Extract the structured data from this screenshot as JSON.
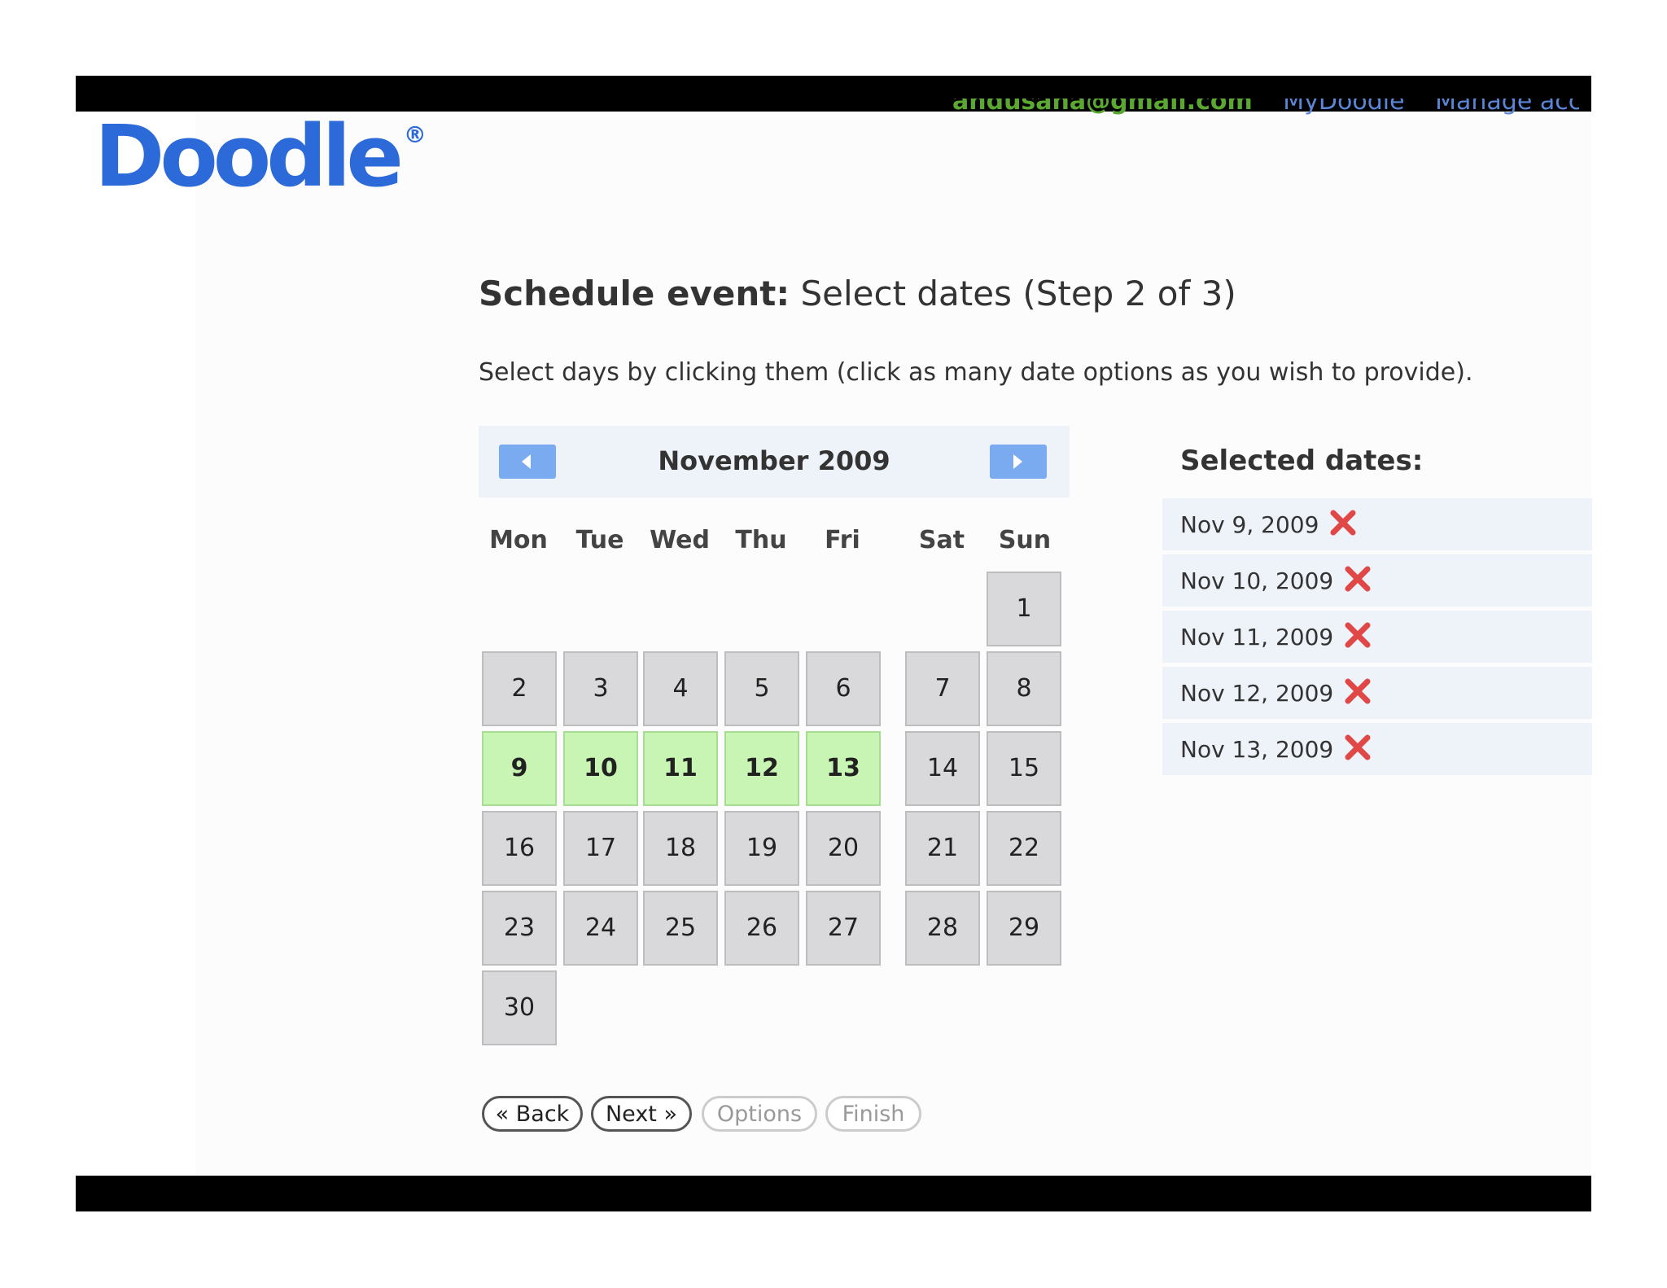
{
  "header": {
    "email": "andusana@gmail.com",
    "links": [
      "MyDoodle",
      "Manage account"
    ]
  },
  "logo": {
    "text": "Doodle",
    "mark": "®"
  },
  "page": {
    "title_bold": "Schedule event:",
    "title_rest": " Select dates (Step 2 of 3)",
    "instructions": "Select days by clicking them (click as many date options as you wish to provide)."
  },
  "calendar": {
    "month_label": "November 2009",
    "prev_icon": "chevron-left-icon",
    "next_icon": "chevron-right-icon",
    "weekdays": [
      "Mon",
      "Tue",
      "Wed",
      "Thu",
      "Fri",
      "Sat",
      "Sun"
    ],
    "days": [
      "1",
      "2",
      "3",
      "4",
      "5",
      "6",
      "7",
      "8",
      "9",
      "10",
      "11",
      "12",
      "13",
      "14",
      "15",
      "16",
      "17",
      "18",
      "19",
      "20",
      "21",
      "22",
      "23",
      "24",
      "25",
      "26",
      "27",
      "28",
      "29",
      "30"
    ],
    "selected_days": [
      9,
      10,
      11,
      12,
      13
    ],
    "colors": {
      "selected": "#c8f5b4",
      "unselected": "#d9d9db",
      "nav": "#7aaaf0"
    }
  },
  "selected": {
    "title": "Selected dates:",
    "dates": [
      "Nov 9, 2009",
      "Nov 10, 2009",
      "Nov 11, 2009",
      "Nov 12, 2009",
      "Nov 13, 2009"
    ],
    "remove_icon": "close-x-icon",
    "remove_color": "#e04848"
  },
  "buttons": {
    "back": "« Back",
    "next": "Next »",
    "options": "Options",
    "finish": "Finish"
  }
}
